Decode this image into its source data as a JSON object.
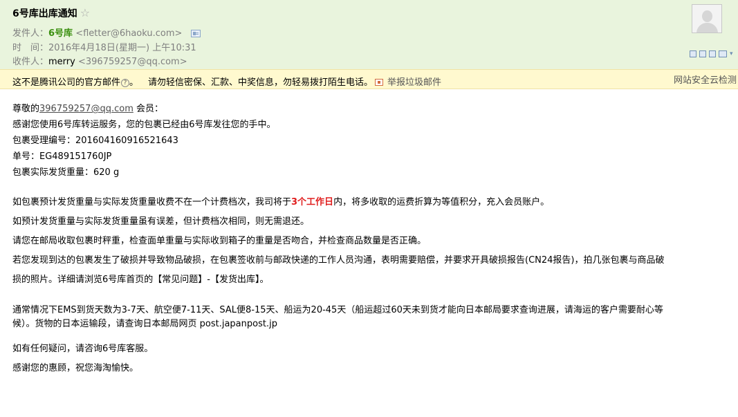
{
  "header": {
    "subject": "6号库出库通知",
    "star_glyph": "☆",
    "from_label": "发件人：",
    "from_name": "6号库",
    "from_addr": "<fletter@6haoku.com>",
    "time_label": "时　间：",
    "time_value": "2016年4月18日(星期一) 上午10:31",
    "to_label": "收件人：",
    "to_name": "merry",
    "to_addr": "<396759257@qq.com>"
  },
  "notice": {
    "official": "这不是腾讯公司的官方邮件",
    "help_glyph": "?",
    "after_help": "。",
    "warning": "请勿轻信密保、汇款、中奖信息，勿轻易拨打陌生电话。",
    "report": "举报垃圾邮件",
    "security": "网站安全云检测"
  },
  "body": {
    "greeting_prefix": "尊敬的",
    "greeting_email": "396759257@qq.com",
    "greeting_suffix": " 会员：",
    "line_thanks": "感谢您使用6号库转运服务，您的包裹已经由6号库发往您的手中。",
    "line_accept": "包裹受理编号：201604160916521643",
    "line_order": "单号：EG489151760JP",
    "line_weight": "包裹实际发货重量：620 g",
    "p1_a": "如包裹预计发货重量与实际发货重量收费不在一个计费档次，我司将于",
    "p1_red": "3个工作日",
    "p1_b": "内，将多收取的运费折算为等值积分，充入会员账户。",
    "p2": "如预计发货重量与实际发货重量虽有误差，但计费档次相同，则无需退还。",
    "p3": "请您在邮局收取包裹时秤重，检查面单重量与实际收到箱子的重量是否吻合，并检查商品数量是否正确。",
    "p4_line1": "若您发现到达的包裹发生了破损并导致物品破损，在包裹签收前与邮政快递的工作人员沟通，表明需要赔偿，并要求开具破损报告(CN24报告)，拍几张包裹与商品破",
    "p4_line2": "损的照片。详细请浏览6号库首页的【常见问题】-【发货出库】。",
    "p5_line1": "通常情况下EMS到货天数为3-7天、航空便7-11天、SAL便8-15天、船运为20-45天（船运超过60天未到货才能向日本邮局要求查询进展，请海运的客户需要耐心等",
    "p5_line2": "候）。货物的日本运输段，请查询日本邮局网页 post.japanpost.jp",
    "p6": "如有任何疑问，请咨询6号库客服。",
    "p7": "感谢您的惠顾，祝您海淘愉快。"
  }
}
